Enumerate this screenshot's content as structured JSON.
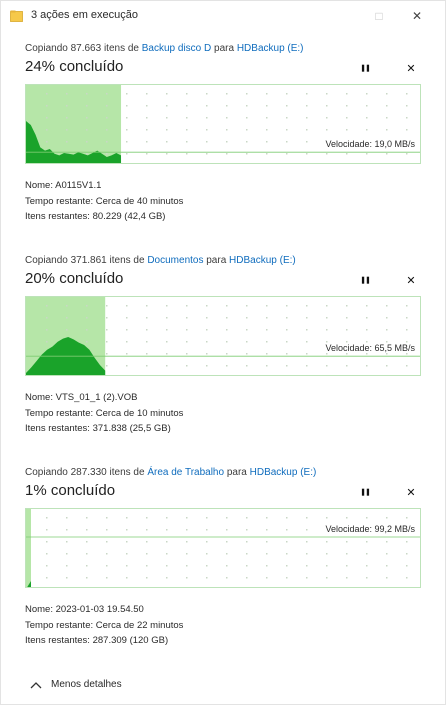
{
  "window": {
    "title": "3 ações em execução",
    "maximize_glyph": "□",
    "close_glyph": "✕"
  },
  "operations": [
    {
      "header_prefix": "Copiando 87.663 itens de ",
      "source": "Backup disco D",
      "header_middle": " para ",
      "destination": "HDBackup (E:)",
      "percent_text": "24% concluído",
      "progress": 0.24,
      "speed_text": "Velocidade: 19,0 MB/s",
      "speed_line": 0.84,
      "pause_glyph": "❚❚",
      "cancel_glyph": "✕",
      "name_label": "Nome:",
      "name_value": "A0115V1.1",
      "time_label": "Tempo restante:",
      "time_value": "Cerca de 40 minutos",
      "items_label": "Itens restantes:",
      "items_value": "80.229 (42,4 GB)"
    },
    {
      "header_prefix": "Copiando 371.861 itens de ",
      "source": "Documentos",
      "header_middle": " para ",
      "destination": "HDBackup (E:)",
      "percent_text": "20% concluído",
      "progress": 0.2,
      "speed_text": "Velocidade: 65,5 MB/s",
      "speed_line": 0.74,
      "pause_glyph": "❚❚",
      "cancel_glyph": "✕",
      "name_label": "Nome:",
      "name_value": "VTS_01_1 (2).VOB",
      "time_label": "Tempo restante:",
      "time_value": "Cerca de 10 minutos",
      "items_label": "Itens restantes:",
      "items_value": "371.838 (25,5 GB)"
    },
    {
      "header_prefix": "Copiando 287.330 itens de ",
      "source": "Área de Trabalho",
      "header_middle": " para ",
      "destination": "HDBackup (E:)",
      "percent_text": "1% concluído",
      "progress": 0.01,
      "speed_text": "Velocidade: 99,2 MB/s",
      "speed_line": 0.35,
      "pause_glyph": "❚❚",
      "cancel_glyph": "✕",
      "name_label": "Nome:",
      "name_value": "2023-01-03 19.54.50",
      "time_label": "Tempo restante:",
      "time_value": "Cerca de 22 minutos",
      "items_label": "Itens restantes:",
      "items_value": "287.309 (120 GB)"
    }
  ],
  "footer": {
    "toggle_label": "Menos detalhes"
  },
  "colors": {
    "link": "#0f6cbd",
    "progress_fill": "#b6e6a8",
    "throughput_fill": "#1aa32a",
    "graph_border": "#bde3b9",
    "grid_dot": "#c9d7c6"
  }
}
